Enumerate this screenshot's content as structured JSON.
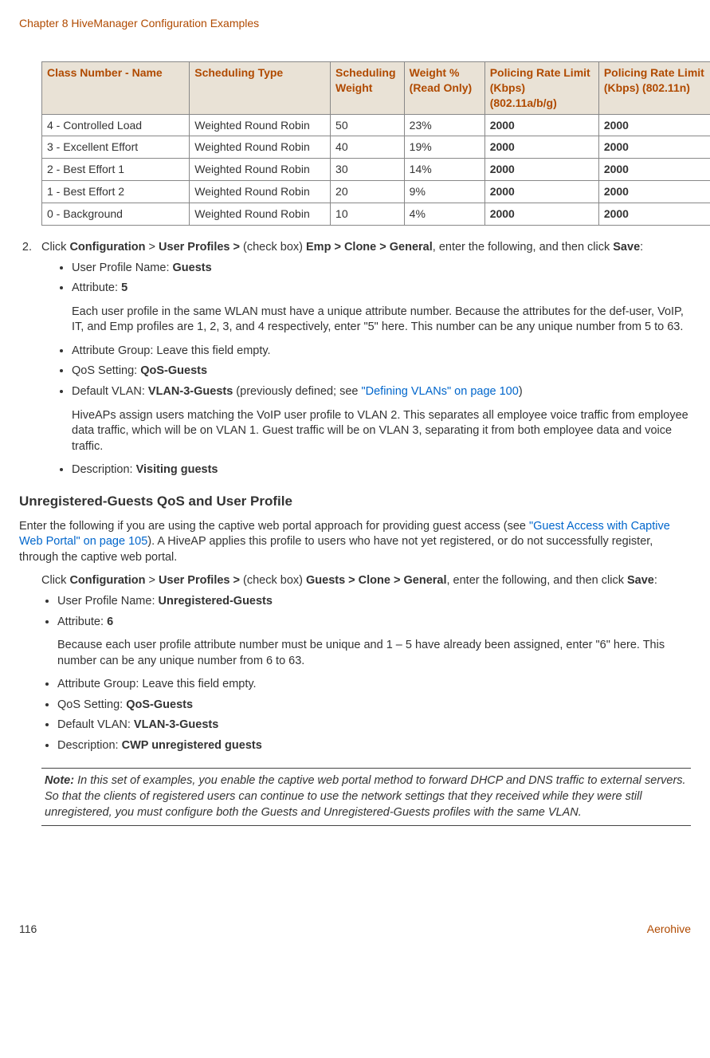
{
  "chapter_head": "Chapter 8 HiveManager Configuration Examples",
  "table": {
    "headers": {
      "name": "Class Number - Name",
      "sched_type": "Scheduling Type",
      "sched_weight": "Scheduling Weight",
      "weight_pct": "Weight % (Read Only)",
      "rate_abg": "Policing Rate Limit (Kbps) (802.11a/b/g)",
      "rate_n": "Policing Rate Limit (Kbps) (802.11n)"
    },
    "rows": [
      {
        "name": "4 - Controlled Load",
        "sched_type": "Weighted Round Robin",
        "sched_weight": "50",
        "weight_pct": "23%",
        "rate_abg": "2000",
        "rate_n": "2000"
      },
      {
        "name": "3 - Excellent Effort",
        "sched_type": "Weighted Round Robin",
        "sched_weight": "40",
        "weight_pct": "19%",
        "rate_abg": "2000",
        "rate_n": "2000"
      },
      {
        "name": "2 - Best Effort 1",
        "sched_type": "Weighted Round Robin",
        "sched_weight": "30",
        "weight_pct": "14%",
        "rate_abg": "2000",
        "rate_n": "2000"
      },
      {
        "name": "1 - Best Effort 2",
        "sched_type": "Weighted Round Robin",
        "sched_weight": "20",
        "weight_pct": "9%",
        "rate_abg": "2000",
        "rate_n": "2000"
      },
      {
        "name": "0 - Background",
        "sched_type": "Weighted Round Robin",
        "sched_weight": "10",
        "weight_pct": "4%",
        "rate_abg": "2000",
        "rate_n": "2000"
      }
    ]
  },
  "step2": {
    "num": "2.",
    "pre": "Click ",
    "path1": "Configuration",
    "gt1": " > ",
    "path2": "User Profiles > ",
    "cb": "(check box) ",
    "path3": "Emp > Clone",
    "path3b": " > General",
    "mid": ", enter the following, and then click ",
    "save": "Save",
    "end": ":"
  },
  "guests_bullets": {
    "upn": {
      "label": "User Profile Name: ",
      "value": "Guests"
    },
    "attr": {
      "label": "Attribute: ",
      "value": "5"
    },
    "attr_note": "Each user profile in the same WLAN must have a unique attribute number. Because the attributes for the def-user, VoIP, IT, and Emp profiles are 1, 2, 3, and 4 respectively, enter \"5\" here. This number can be any unique number from 5 to 63.",
    "attr_group": "Attribute Group: Leave this field empty.",
    "qos": {
      "label": "QoS Setting: ",
      "value": "QoS-Guests"
    },
    "vlan": {
      "label": "Default VLAN: ",
      "value": "VLAN-3-Guests",
      "after": " (previously defined; see ",
      "link": "\"Defining VLANs\" on page 100",
      "close": ")"
    },
    "vlan_para": "HiveAPs assign users matching the VoIP user profile to VLAN 2. This separates all employee voice traffic from employee data traffic, which will be on VLAN 1. Guest traffic will be on VLAN 3, separating it from both employee data and voice traffic.",
    "desc": {
      "label": "Description: ",
      "value": "Visiting guests"
    }
  },
  "unreg_heading": "Unregistered-Guests QoS and User Profile",
  "unreg_intro": {
    "pre": "Enter the following if you are using the captive web portal approach for providing guest access (see ",
    "link": "\"Guest Access with Captive Web Portal\" on page 105",
    "post": "). A HiveAP applies this profile to users who have not yet registered, or do not successfully register, through the captive web portal."
  },
  "unreg_step": {
    "pre": "Click ",
    "path1": "Configuration",
    "gt1": " > ",
    "path2": "User Profiles > ",
    "cb": "(check box) ",
    "path3": "Guests > Clone",
    "path3b": " > General",
    "mid": ", enter the following, and then click ",
    "save": "Save",
    "end": ":"
  },
  "unreg_bullets": {
    "upn": {
      "label": "User Profile Name: ",
      "value": "Unregistered-Guests"
    },
    "attr": {
      "label": "Attribute: ",
      "value": "6"
    },
    "attr_note": "Because each user profile attribute number must be unique and 1 – 5 have already been assigned, enter \"6\" here. This number can be any unique number from 6 to 63.",
    "attr_group": "Attribute Group: Leave this field empty.",
    "qos": {
      "label": "QoS Setting: ",
      "value": "QoS-Guests"
    },
    "vlan": {
      "label": "Default VLAN: ",
      "value": "VLAN-3-Guests"
    },
    "desc": {
      "label": "Description: ",
      "value": "CWP unregistered guests"
    }
  },
  "note": {
    "label": "Note:",
    "text": " In this set of examples, you enable the captive web portal method to forward DHCP and DNS traffic to external servers. So that the clients of registered users can continue to use the network settings that they received while they were still unregistered, you must configure both the Guests and Unregistered-Guests profiles with the same VLAN."
  },
  "footer": {
    "page": "116",
    "brand": "Aerohive"
  }
}
